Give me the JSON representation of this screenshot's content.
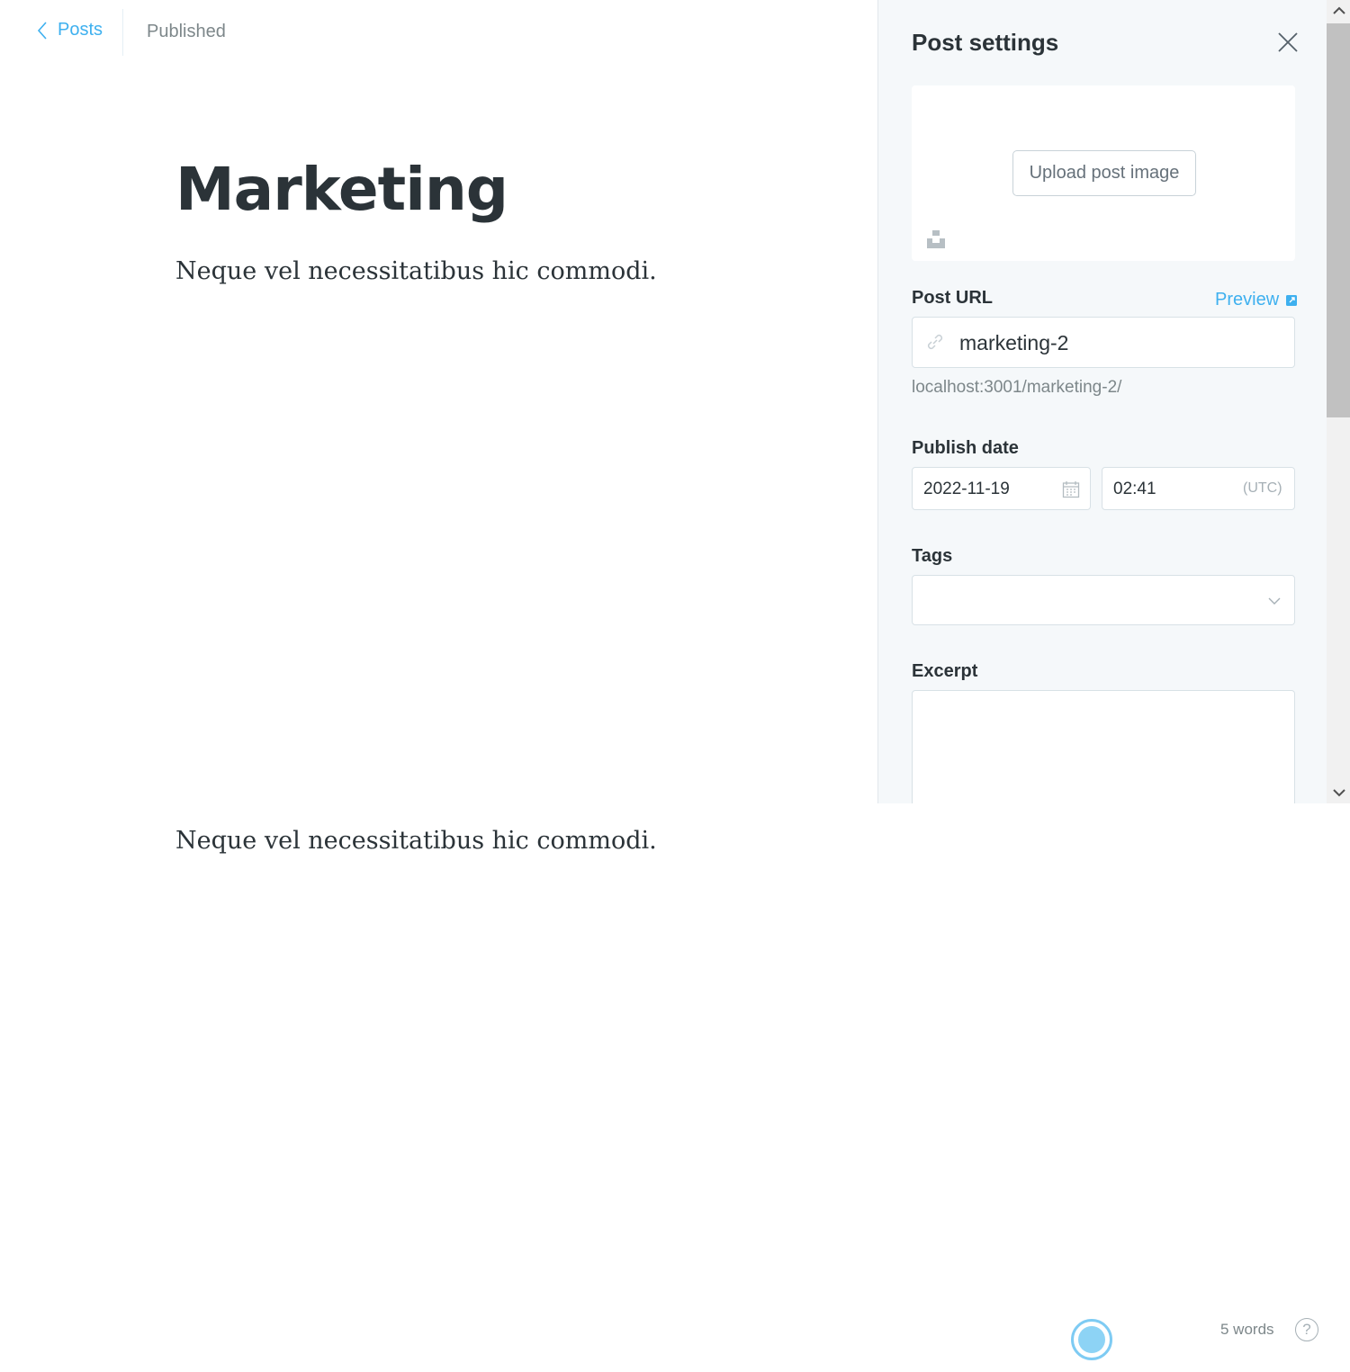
{
  "nav": {
    "back_label": "Posts",
    "status": "Published"
  },
  "post": {
    "title": "Marketing",
    "paragraphs": [
      "Neque vel necessitatibus hic commodi.",
      "Neque vel necessitatibus hic commodi."
    ]
  },
  "settings": {
    "title": "Post settings",
    "upload_label": "Upload post image",
    "url_label": "Post URL",
    "preview_label": "Preview",
    "slug": "marketing-2",
    "url_hint": "localhost:3001/marketing-2/",
    "publish_date_label": "Publish date",
    "date": "2022-11-19",
    "time": "02:41",
    "timezone": "(UTC)",
    "tags_label": "Tags",
    "excerpt_label": "Excerpt"
  },
  "footer": {
    "word_count": "5 words",
    "help": "?"
  },
  "colors": {
    "accent": "#3eb0ef",
    "panel_bg": "#f5f8fa",
    "text": "#2b3338",
    "muted": "#7d878a"
  },
  "icons": [
    "chevron-left-icon",
    "close-icon",
    "unsplash-icon",
    "link-icon",
    "external-link-icon",
    "calendar-icon",
    "chevron-down-icon",
    "help-icon"
  ]
}
